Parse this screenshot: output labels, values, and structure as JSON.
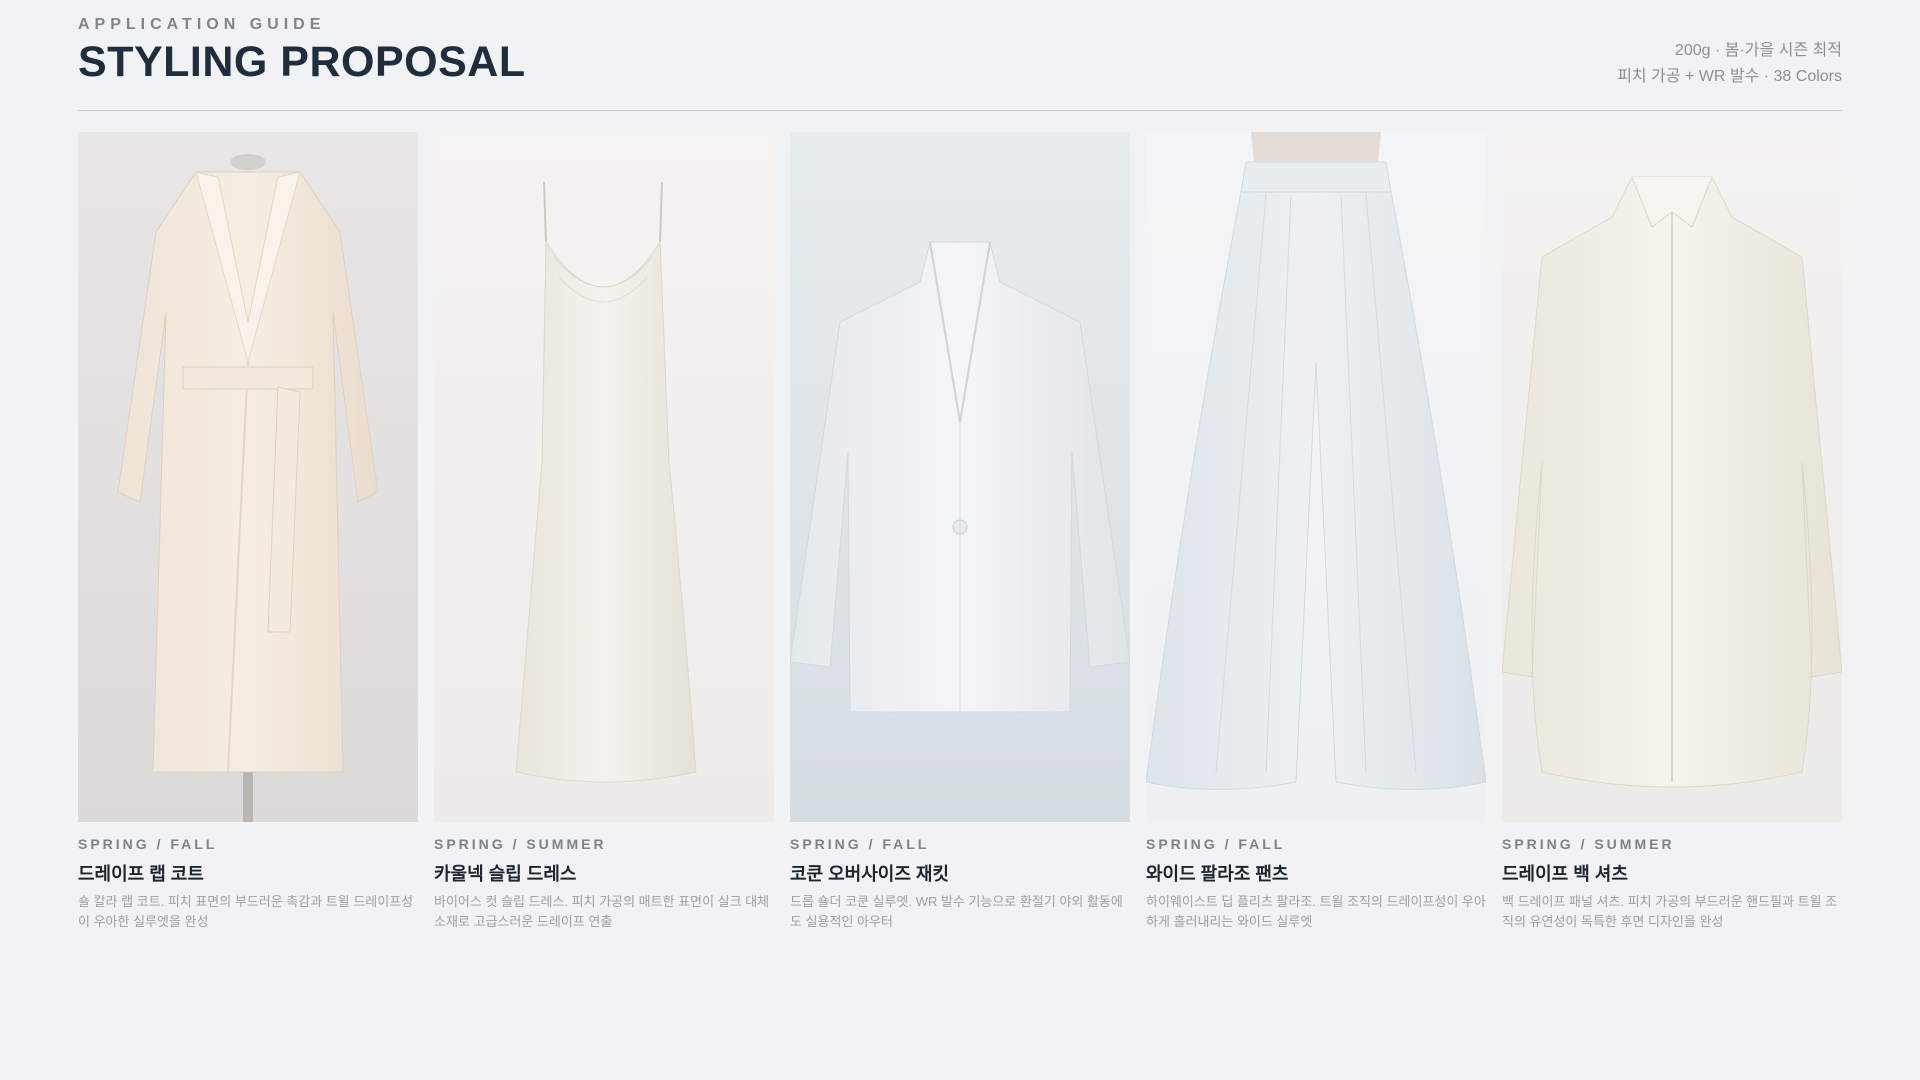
{
  "header": {
    "eyebrow": "APPLICATION GUIDE",
    "title": "STYLING PROPOSAL",
    "meta_line1": "200g · 봄·가을 시즌 최적",
    "meta_line2": "피치 가공 + WR 발수 · 38 Colors"
  },
  "colors": {
    "background": "#f1f2f3",
    "title": "#1f2d3d",
    "muted": "#8a9099"
  },
  "items": [
    {
      "season": "SPRING / FALL",
      "name": "드레이프 랩 코트",
      "desc": "숄 칼라 랩 코트. 피치 표면의 부드러운 촉감과 트윌 드레이프성이 우아한 실루엣을 완성",
      "icon": "wrap-coat-image"
    },
    {
      "season": "SPRING / SUMMER",
      "name": "카울넥 슬립 드레스",
      "desc": "바이어스 컷 슬립 드레스. 피치 가공의 매트한 표면이 실크 대체 소재로 고급스러운 드레이프 연출",
      "icon": "slip-dress-image"
    },
    {
      "season": "SPRING / FALL",
      "name": "코쿤 오버사이즈 재킷",
      "desc": "드롭 숄더 코쿤 실루엣. WR 발수 기능으로 환절기 야외 활동에도 실용적인 아우터",
      "icon": "oversize-jacket-image"
    },
    {
      "season": "SPRING / FALL",
      "name": "와이드 팔라조 팬츠",
      "desc": "하이웨이스트 딥 플리츠 팔라조. 트윌 조직의 드레이프성이 우아하게 흘러내리는 와이드 실루엣",
      "icon": "palazzo-pants-image"
    },
    {
      "season": "SPRING / SUMMER",
      "name": "드레이프 백 셔츠",
      "desc": "백 드레이프 패널 셔츠. 피치 가공의 부드러운 핸드필과 트윌 조직의 유연성이 독특한 후면 디자인을 완성",
      "icon": "drape-shirt-image"
    }
  ]
}
